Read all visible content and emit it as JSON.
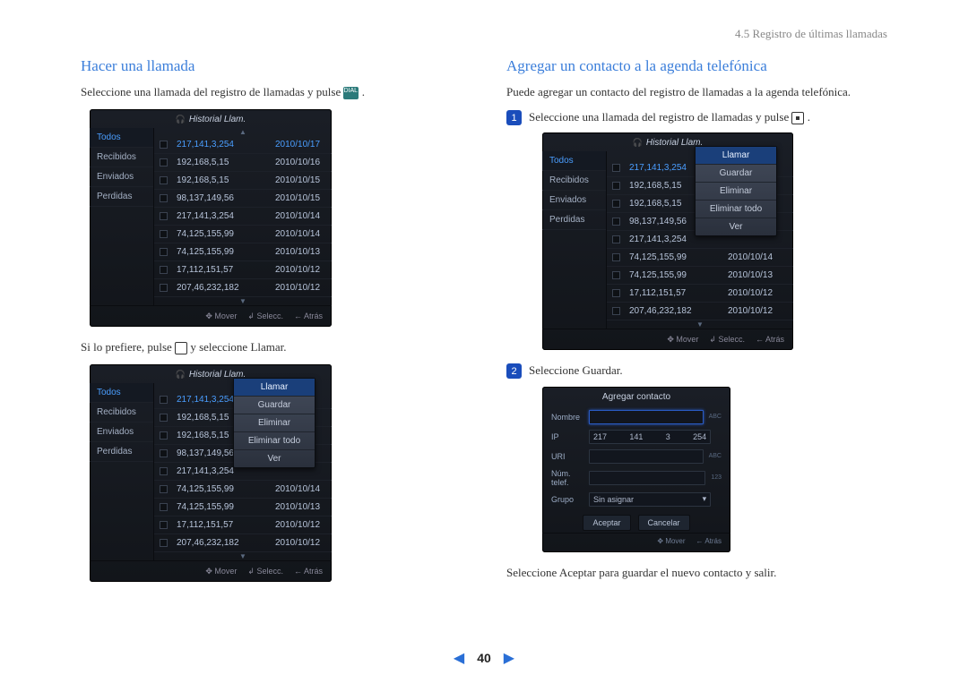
{
  "breadcrumb": "4.5 Registro de últimas llamadas",
  "left": {
    "heading": "Hacer una llamada",
    "intro_a": "Seleccione una llamada del registro de llamadas y pulse ",
    "intro_b": ".",
    "alt_a": "Si lo prefiere, pulse ",
    "alt_b": " y seleccione Llamar."
  },
  "right": {
    "heading": "Agregar un contacto a la agenda telefónica",
    "intro": "Puede agregar un contacto del registro de llamadas a la agenda telefónica.",
    "step1_a": "Seleccione una llamada del registro de llamadas y pulse ",
    "step1_b": ".",
    "step2": "Seleccione Guardar.",
    "outro": "Seleccione Aceptar para guardar el nuevo contacto y salir."
  },
  "ui": {
    "title": "Historial Llam.",
    "side": [
      "Todos",
      "Recibidos",
      "Enviados",
      "Perdidas"
    ],
    "rows": [
      {
        "ip": "217,141,3,254",
        "date": "2010/10/17"
      },
      {
        "ip": "192,168,5,15",
        "date": "2010/10/16"
      },
      {
        "ip": "192,168,5,15",
        "date": "2010/10/15"
      },
      {
        "ip": "98,137,149,56",
        "date": "2010/10/15"
      },
      {
        "ip": "217,141,3,254",
        "date": "2010/10/14"
      },
      {
        "ip": "74,125,155,99",
        "date": "2010/10/14"
      },
      {
        "ip": "74,125,155,99",
        "date": "2010/10/13"
      },
      {
        "ip": "17,112,151,57",
        "date": "2010/10/12"
      },
      {
        "ip": "207,46,232,182",
        "date": "2010/10/12"
      }
    ],
    "popup": [
      "Llamar",
      "Guardar",
      "Eliminar",
      "Eliminar todo",
      "Ver"
    ],
    "footer": {
      "mover": "Mover",
      "selecc": "Selecc.",
      "atras": "Atrás"
    }
  },
  "add": {
    "title": "Agregar contacto",
    "labels": {
      "nombre": "Nombre",
      "ip": "IP",
      "uri": "URI",
      "num": "Núm. telef.",
      "grupo": "Grupo"
    },
    "ip": [
      "217",
      "141",
      "3",
      "254"
    ],
    "grupo": "Sin asignar",
    "tags": {
      "abc": "ABC",
      "num": "123"
    },
    "btns": {
      "aceptar": "Aceptar",
      "cancelar": "Cancelar"
    },
    "foot": {
      "mover": "Mover",
      "atras": "Atrás"
    }
  },
  "page": "40"
}
